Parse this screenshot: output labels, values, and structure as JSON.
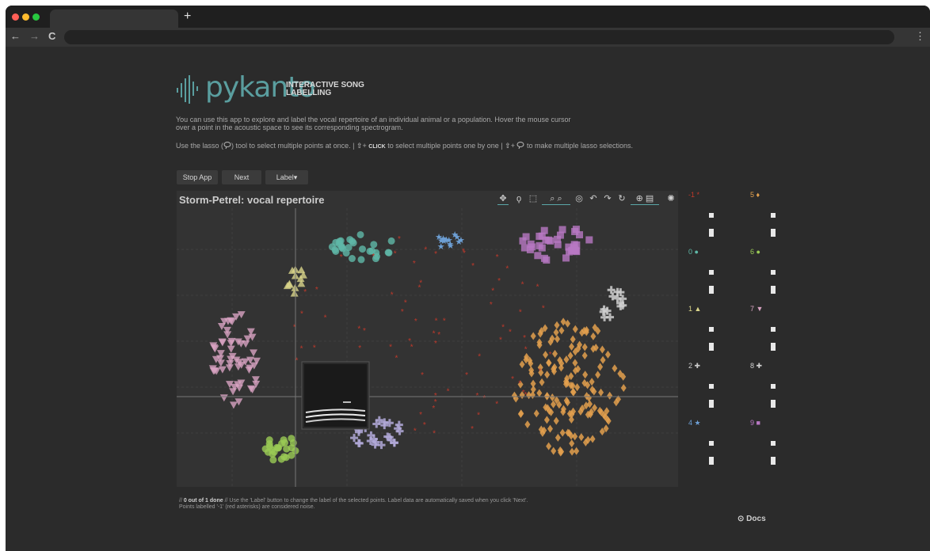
{
  "browser": {
    "new_tab_label": "+",
    "back": "←",
    "forward": "→",
    "reload": "C",
    "menu": "⋮"
  },
  "header": {
    "logo_word": "pykanto",
    "subtitle_line1": "INTERACTIVE SONG",
    "subtitle_line2": "LABELLING",
    "intro_line1": "You can use this app to explore and label the vocal repertoire of an individual animal or a population. Hover the mouse cursor",
    "intro_line2": "over a point in the acoustic space to see its corresponding spectrogram.",
    "hint_part1": "Use the lasso (",
    "hint_part2": ") tool to select multiple points at once. |",
    "hint_part3": "+",
    "hint_click": "CLICK",
    "hint_part4": "to select multiple points one by one |",
    "hint_part5": "+",
    "hint_part6": "to make multiple lasso selections."
  },
  "controls": {
    "stop_label": "Stop App",
    "next_label": "Next",
    "label_label": "Label▾"
  },
  "plot": {
    "title": "Storm-Petrel: vocal repertoire"
  },
  "legend": {
    "items": [
      {
        "label": "-1",
        "marker": "*",
        "color": "#c0392b"
      },
      {
        "label": "0",
        "marker": "●",
        "color": "#5fb8a7"
      },
      {
        "label": "1",
        "marker": "▲",
        "color": "#d9d48a"
      },
      {
        "label": "2",
        "marker": "✚",
        "color": "#c9c9c9"
      },
      {
        "label": "4",
        "marker": "★",
        "color": "#6d9fd4"
      },
      {
        "label": "5",
        "marker": "♦",
        "color": "#e3a04e"
      },
      {
        "label": "6",
        "marker": "●",
        "color": "#9acb55"
      },
      {
        "label": "7",
        "marker": "▼",
        "color": "#d8a3c2"
      },
      {
        "label": "8",
        "marker": "✚",
        "color": "#d0d0d0"
      },
      {
        "label": "9",
        "marker": "■",
        "color": "#b878c3"
      }
    ]
  },
  "footer": {
    "progress": "0 out of 1 done",
    "text1": " // Use the 'Label' button to change the label of the selected points. Label data are automatically saved when you click 'Next'.",
    "text2": "Points labelled '-1' (red asterisks) are considered noise."
  },
  "docs": {
    "label": "Docs"
  },
  "colors": {
    "accent": "#5a9e9f",
    "background": "#2b2b2b",
    "plot_bg": "#333333"
  }
}
